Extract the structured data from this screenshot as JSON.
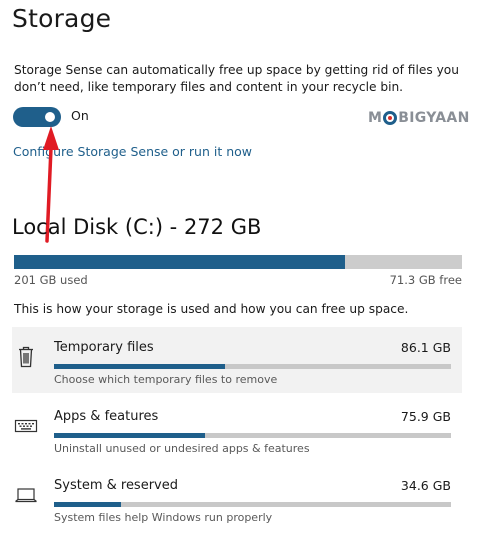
{
  "page": {
    "title": "Storage",
    "description": "Storage Sense can automatically free up space by getting rid of files you don’t need, like temporary files and content in your recycle bin."
  },
  "storage_sense": {
    "toggle_state": "On",
    "toggle_on": true,
    "configure_link": "Configure Storage Sense or run it now"
  },
  "watermark": {
    "before": "M",
    "after": "BIGYAAN"
  },
  "disk": {
    "title": "Local Disk (C:) - 272 GB",
    "used_label": "201 GB used",
    "free_label": "71.3 GB free",
    "used_fraction": 0.738
  },
  "info_text": "This is how your storage is used and how you can free up space.",
  "categories": [
    {
      "name": "Temporary files",
      "size": "86.1 GB",
      "description": "Choose which temporary files to remove",
      "fraction": 0.43,
      "icon": "trash-icon",
      "selected": true
    },
    {
      "name": "Apps & features",
      "size": "75.9 GB",
      "description": "Uninstall unused or undesired apps & features",
      "fraction": 0.38,
      "icon": "keyboard-icon",
      "selected": false
    },
    {
      "name": "System & reserved",
      "size": "34.6 GB",
      "description": "System files help Windows run properly",
      "fraction": 0.17,
      "icon": "laptop-icon",
      "selected": false
    }
  ],
  "colors": {
    "accent": "#1f5f8b",
    "annotation_arrow": "#e01b24",
    "bar_track": "#cccccc"
  }
}
